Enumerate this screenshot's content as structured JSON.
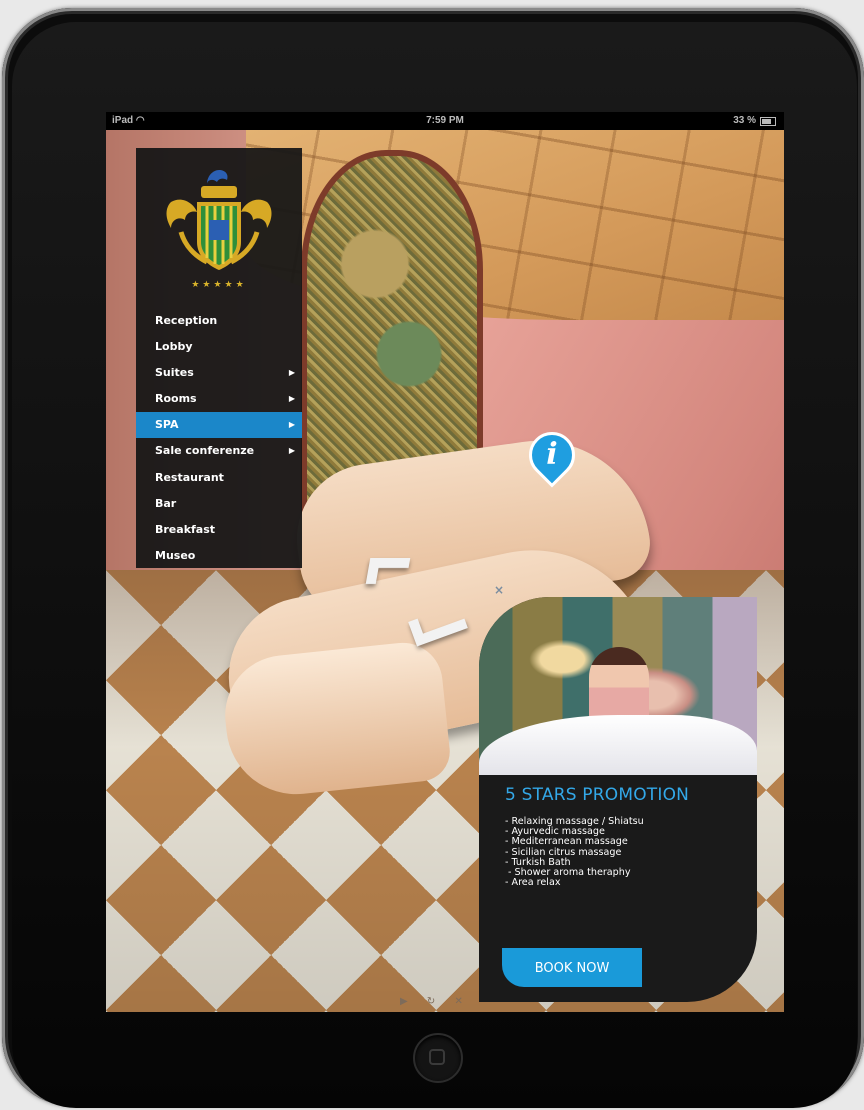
{
  "status_bar": {
    "device": "iPad",
    "time": "7:59 PM",
    "battery": "33 %"
  },
  "menu": {
    "stars": "★★★★★",
    "items": [
      {
        "label": "Reception",
        "submenu": false,
        "active": false
      },
      {
        "label": "Lobby",
        "submenu": false,
        "active": false
      },
      {
        "label": "Suites",
        "submenu": true,
        "active": false
      },
      {
        "label": "Rooms",
        "submenu": true,
        "active": false
      },
      {
        "label": "SPA",
        "submenu": true,
        "active": true
      },
      {
        "label": "Sale conferenze",
        "submenu": true,
        "active": false
      },
      {
        "label": "Restaurant",
        "submenu": false,
        "active": false
      },
      {
        "label": "Bar",
        "submenu": false,
        "active": false
      },
      {
        "label": "Breakfast",
        "submenu": false,
        "active": false
      },
      {
        "label": "Museo",
        "submenu": false,
        "active": false
      }
    ]
  },
  "hotspot": {
    "info_glyph": "i"
  },
  "promo": {
    "close": "×",
    "title": "5 STARS PROMOTION",
    "items": [
      "- Relaxing massage / Shiatsu",
      "- Ayurvedic massage",
      "- Mediterranean massage",
      "- Sicilian citrus massage",
      "- Turkish Bath",
      " - Shower aroma theraphy",
      "- Area relax"
    ],
    "book_label": "BOOK NOW"
  },
  "player_controls": {
    "play": "▶",
    "refresh": "↻",
    "close": "✕"
  },
  "colors": {
    "accent": "#1b87c9",
    "promo_title": "#33a8e8",
    "menu_bg": "#161616",
    "stars": "#d9b32b"
  }
}
